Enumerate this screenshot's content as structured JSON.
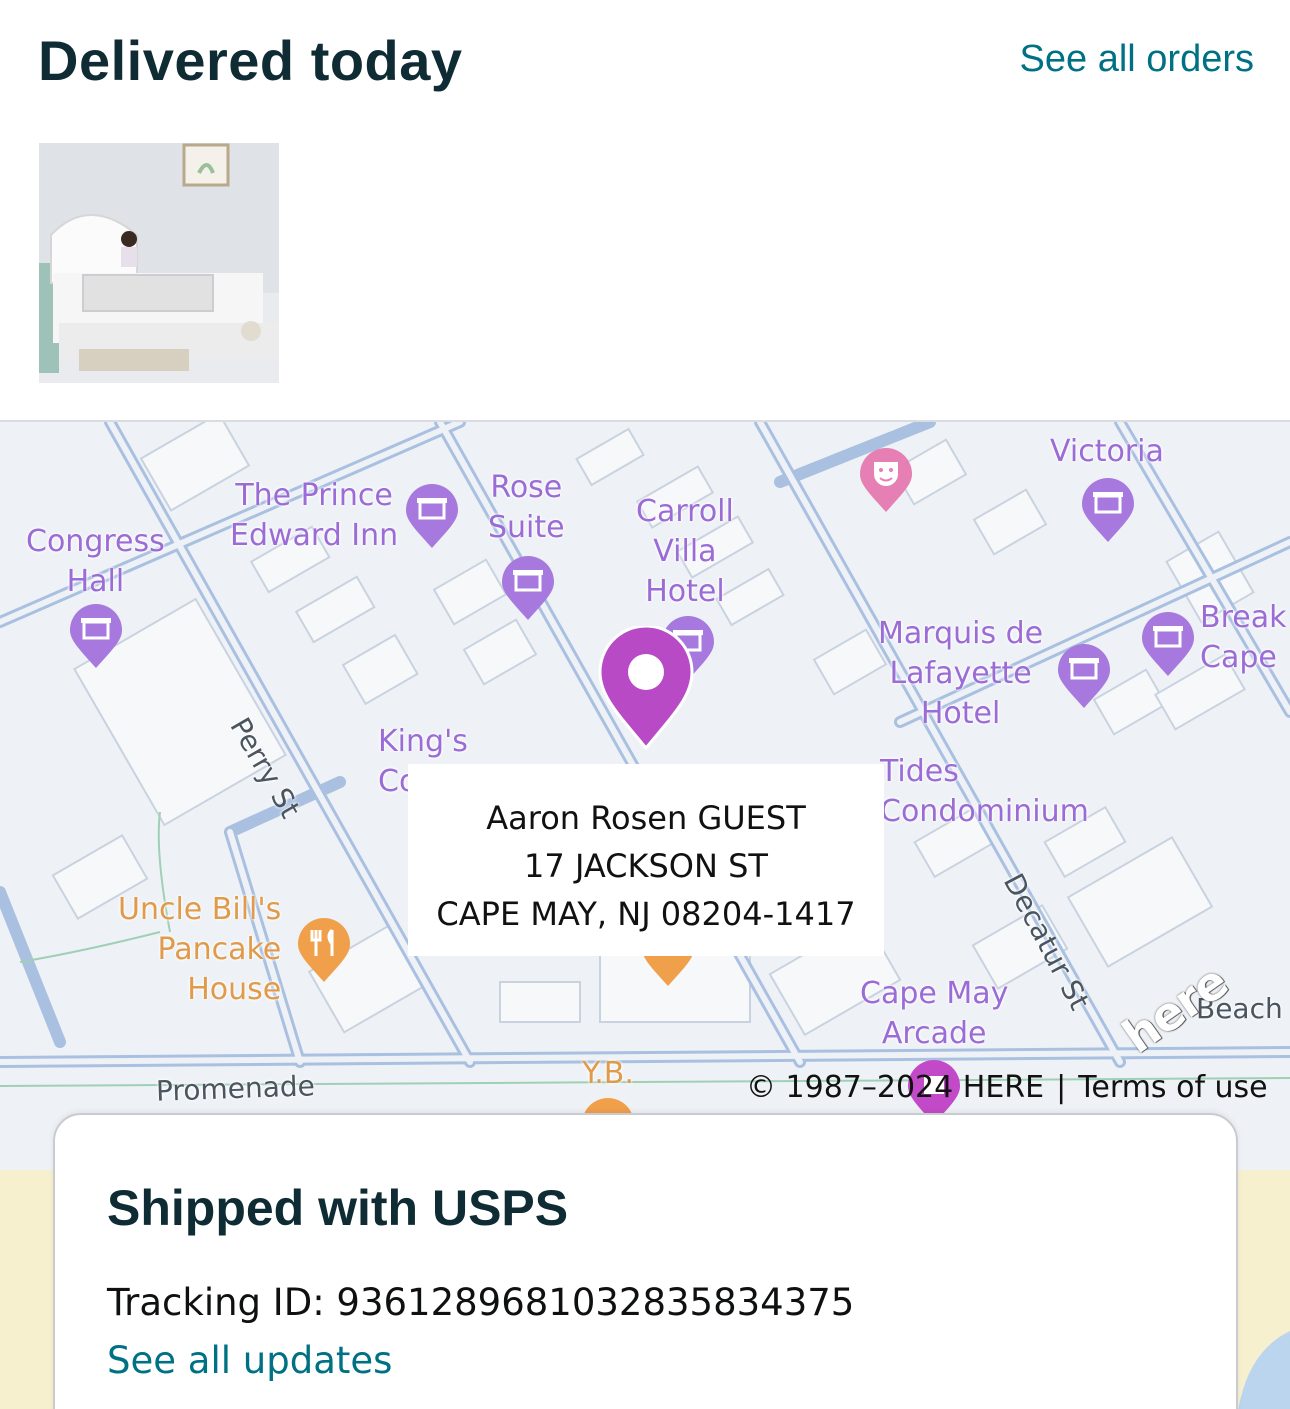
{
  "header": {
    "title": "Delivered today",
    "see_all_orders": "See all orders"
  },
  "product": {
    "image_alt": "bed rail product thumbnail"
  },
  "map": {
    "pois": [
      {
        "label": "Congress\nHall",
        "icon": "hotel-icon"
      },
      {
        "label": "The Prince\nEdward Inn",
        "icon": "hotel-icon"
      },
      {
        "label": "Rose\nSuite",
        "icon": "hotel-icon"
      },
      {
        "label": "Carroll\nVilla\nHotel",
        "icon": "hotel-icon"
      },
      {
        "label": "Victoria",
        "icon": "hotel-icon"
      },
      {
        "label": "Marquis de\nLafayette\nHotel",
        "icon": "hotel-icon"
      },
      {
        "label": "Break\nCape",
        "icon": "hotel-icon"
      },
      {
        "label": "King's\nCo",
        "icon": "none"
      },
      {
        "label": "Tides\nCondominium",
        "icon": "none"
      },
      {
        "label": "Uncle Bill's\nPancake\nHouse",
        "icon": "restaurant-icon"
      },
      {
        "label": "Cape May\nArcade",
        "icon": "entertainment-icon"
      },
      {
        "label": "Y.B.",
        "icon": "restaurant-icon"
      }
    ],
    "streets": {
      "perry": "Perry St",
      "decatur": "Decatur St",
      "promenade": "Promenade",
      "beach": "Beach"
    },
    "address": {
      "name": "Aaron Rosen GUEST",
      "street": "17 JACKSON ST",
      "city": "CAPE MAY, NJ 08204-1417"
    },
    "copyright": "© 1987–2024 HERE",
    "separator": "|",
    "terms": "Terms of use",
    "provider_logo": "here",
    "pin_color": "#b84ac6"
  },
  "shipment": {
    "title": "Shipped with USPS",
    "tracking": "Tracking ID: 9361289681032835834375",
    "see_updates": "See all updates"
  },
  "colors": {
    "heading": "#0f2b33",
    "link": "#007185",
    "poi_hotel": "#9b6bd6",
    "poi_food": "#e09a4a"
  }
}
